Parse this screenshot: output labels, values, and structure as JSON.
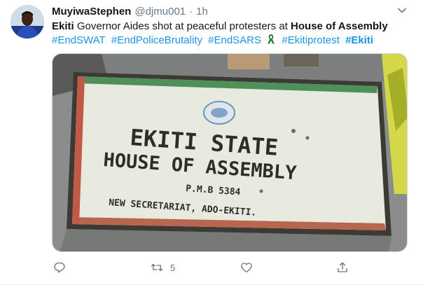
{
  "tweet": {
    "author_name": "MuyiwaStephen",
    "handle": "@djmu001",
    "separator": "·",
    "time": "1h",
    "text_bold_1": "Ekiti",
    "text_plain": " Governor Aides shot at peaceful protesters at ",
    "text_bold_2": "House of Assembly",
    "hashtags": [
      "#EndSWAT",
      "#EndPoliceBrutality",
      "#EndSARS",
      "#Ekitiprotest",
      "#Ekiti"
    ],
    "hashtag_last_bold": true
  },
  "media": {
    "sign_line_1": "EKITI STATE",
    "sign_line_2": "HOUSE OF ASSEMBLY",
    "sign_line_3": "P.M.B 5384",
    "sign_line_4": "NEW SECRETARIAT, ADO-EKITI."
  },
  "actions": {
    "reply_count": "",
    "retweet_count": "5",
    "like_count": ""
  },
  "icons": {
    "avatar": "avatar",
    "caret": "chevron-down-icon",
    "ribbon": "ribbon-emoji-icon",
    "reply": "reply-icon",
    "retweet": "retweet-icon",
    "like": "heart-icon",
    "share": "share-icon"
  },
  "colors": {
    "link": "#1b95e0",
    "muted": "#657786",
    "text": "#14171a",
    "ribbon_green": "#2e7d32"
  }
}
